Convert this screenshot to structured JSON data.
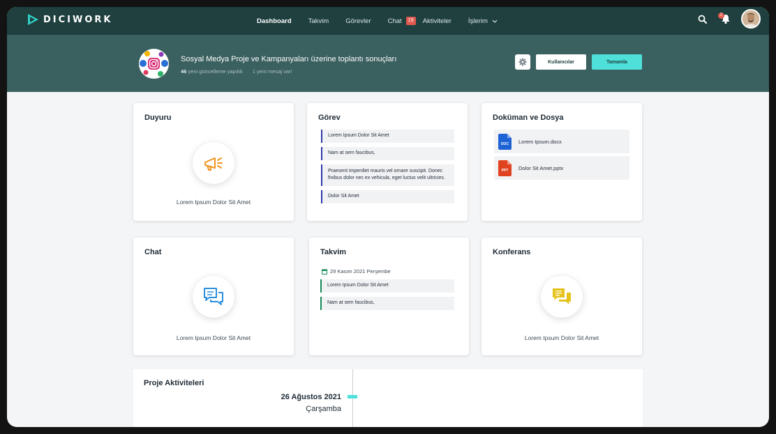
{
  "app": {
    "logo_text": "DICIWORK"
  },
  "nav": {
    "items": [
      {
        "label": "Dashboard"
      },
      {
        "label": "Takvim"
      },
      {
        "label": "Görevler"
      },
      {
        "label": "Chat",
        "badge": "19"
      },
      {
        "label": "Aktiviteler"
      },
      {
        "label": "İşlerim"
      }
    ],
    "notification_count": "2"
  },
  "project": {
    "title": "Sosyal Medya Proje ve Kampanyaları üzerine toplantı sonuçları",
    "updates_count": "46",
    "updates_text": "yeni güncelleme yapıldı",
    "messages_text": "1 yeni mesaj var!",
    "users_button": "Kullanıcılar",
    "complete_button": "Tamamla"
  },
  "cards": {
    "duyuru": {
      "title": "Duyuru",
      "caption": "Lorem Ipsum Dolor Sit Amet"
    },
    "gorev": {
      "title": "Görev",
      "tasks": [
        "Lorem Ipsum Dolor Sit Amet",
        "Nam at sem faucibus,",
        "Praesent imperdiet mauris vel ornare suscipit. Donec finibus dolor nec ex vehicula, eget luctus velit ultricies.",
        "Dolor Sit Amet"
      ]
    },
    "dokuman": {
      "title": "Doküman ve Dosya",
      "files": [
        {
          "name": "Lorem Ipsum.docx",
          "type": "DOC",
          "color": "#1e63d6"
        },
        {
          "name": "Dolor Sit Amet.pptx",
          "type": "PPT",
          "color": "#e0421f"
        }
      ]
    },
    "chat": {
      "title": "Chat",
      "caption": "Lorem Ipsum Dolor Sit Amet"
    },
    "takvim": {
      "title": "Takvim",
      "date": "29 Kasım 2021 Perşembe",
      "events": [
        "Lorem Ipsum Dolor Sit Amet",
        "Nam at sem faucibus,"
      ]
    },
    "konferans": {
      "title": "Konferans",
      "caption": "Lorem Ipsum Dolor Sit Amet"
    }
  },
  "activities": {
    "title": "Proje Aktiviteleri",
    "date": "26 Ağustos 2021",
    "day": "Çarşamba"
  },
  "colors": {
    "nav_bg": "#1f403f",
    "band_bg": "#3a605f",
    "accent": "#4fe0d9",
    "badge": "#e15a4f",
    "announce_icon": "#f0931e",
    "chat_icon": "#2b8fe0",
    "conference_icon": "#e6c21c"
  }
}
